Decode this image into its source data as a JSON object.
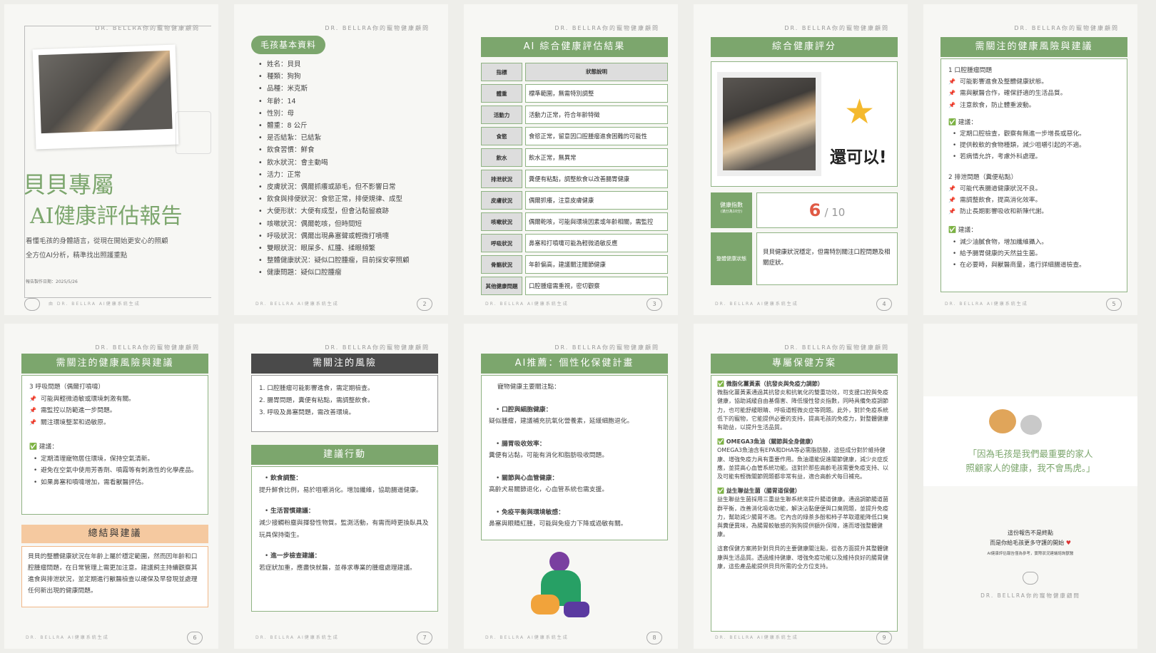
{
  "header": "DR. BELLRA你的寵物健康顧問",
  "footer": "DR. BELLRA AI健康系統生成",
  "p1": {
    "title1": "貝貝專屬",
    "title2": "AI健康評估報告",
    "desc1": "看懂毛孩的身體語言，從現在開始更安心的照顧",
    "desc2": "全方位AI分析，精準找出照護重點",
    "date": "報告製作日期：2025/5/26",
    "footer": "由 DR. BELLRA AI健康系統生成"
  },
  "p2": {
    "title": "毛孩基本資料",
    "items": [
      "姓名：貝貝",
      "種類：狗狗",
      "品種：米克斯",
      "年齡：14",
      "性別：母",
      "體重：8 公斤",
      "是否結紮：已結紮",
      "飲食習慣：鮮食",
      "飲水狀況：會主動喝",
      "活力：正常",
      "皮膚狀況：偶爾抓癢或舔毛，但不影響日常",
      "飲食與排便狀況：食慾正常，排便規律、成型",
      "大便形狀：大便有成型，但會沾黏留痕跡",
      "咳嗽狀況：偶爾乾咳，但時間短",
      "呼吸狀況：偶爾出現鼻塞聲或輕微打噴嚏",
      "雙眼狀況：眼屎多、紅腫、揉眼頻繁",
      "整體健康狀況：疑似口腔腫瘤，目前採安寧照顧",
      "健康問題：疑似口腔腫瘤"
    ],
    "page": "2"
  },
  "p3": {
    "title": "AI 綜合健康評估結果",
    "col1": "指標",
    "col2": "狀態說明",
    "rows": [
      [
        "體重",
        "標準範圍，無需特別調整"
      ],
      [
        "活動力",
        "活動力正常，符合年齡特徵"
      ],
      [
        "食慾",
        "食慾正常，留意因口腔腫瘤進食困難的可能性"
      ],
      [
        "飲水",
        "飲水正常，無異常"
      ],
      [
        "排泄狀況",
        "糞便有粘點，調整飲食以改善腸胃健康"
      ],
      [
        "皮膚狀況",
        "偶爾抓癢，注意皮膚健康"
      ],
      [
        "咳嗽狀況",
        "偶爾乾咳，可能與環境因素或年齡相關，需監控"
      ],
      [
        "呼吸狀況",
        "鼻塞和打噴嚏可能為輕微過敏反應"
      ],
      [
        "骨骼狀況",
        "年齡偏高，建議關注關節健康"
      ],
      [
        "其他健康問題",
        "口腔腫瘤需重視，密切觀察"
      ]
    ],
    "page": "3"
  },
  "p4": {
    "title": "綜合健康評分",
    "praise": "還可以!",
    "index_label": "健康指數",
    "index_sub": "(滿分為10分)",
    "score": "6",
    "score_max": "/ 10",
    "status_label": "整體健康狀態",
    "status_text": "貝貝健康狀況穩定，但需特別關注口腔問題及相關症狀。",
    "page": "4"
  },
  "p5": {
    "title": "需關注的健康風險與建議",
    "s1": "1 口腔腫瘤問題",
    "s1_pins": [
      "可能影響進食及整體健康狀態。",
      "需與獸醫合作，確保舒適的生活品質。",
      "注意飲食，防止體重波動。"
    ],
    "s1_adv": "建議：",
    "s1_tips": [
      "定期口腔檢查，觀察有無進一步增長或惡化。",
      "提供較軟的食物種類，減少咀嚼引起的不適。",
      "若病情允許，考慮外科處理。"
    ],
    "s2": "2 排泄問題（糞便粘點）",
    "s2_pins": [
      "可能代表腸道健康狀況不良。",
      "需調整飲食，提高消化效率。",
      "防止長期影響吸收和新陳代謝。"
    ],
    "s2_adv": "建議：",
    "s2_tips": [
      "減少油膩食物，增加纖維攝入。",
      "給予腸胃健康的天然益生菌。",
      "在必要時，與獸醫商量，進行詳細腸道檢查。"
    ],
    "page": "5"
  },
  "p6": {
    "title": "需關注的健康風險與建議",
    "s3": "3 呼吸問題（偶爾打噴嚏）",
    "pins": [
      "可能與輕微過敏或環境刺激有關。",
      "需監控以防範進一步問題。",
      "關注環境整潔和過敏原。"
    ],
    "adv": "建議：",
    "tips": [
      "定期清理寵物居住環境，保持空氣清新。",
      "避免在空氣中使用芳香劑、噴霧等有刺激性的化學產品。",
      "如果鼻塞和噴嚏增加，需看獸醫評估。"
    ],
    "sum_title": "總結與建議",
    "summary": "貝貝的整體健康狀況在年齡上屬於穩定範圍，然而因年齡和口腔腫瘤問題，在日常管理上需更加注意。建議飼主持續觀察其進食與排泄狀況，並定期進行獸醫檢查以確保及早發現並處理任何新出現的健康問題。",
    "page": "6"
  },
  "p7": {
    "title": "需關注的風險",
    "risks": [
      "1. 口腔腫瘤可能影響進食，需定期檢查。",
      "2. 腸胃問題，糞便有粘點，需調整飲食。",
      "3. 呼吸及鼻塞問題，需改善環境。"
    ],
    "action_title": "建議行動",
    "a1": "飲食調整：",
    "a1_text": "提升鮮食比例，易於咀嚼消化。增加纖維，協助腸道健康。",
    "a2": "生活習慣建議：",
    "a2_text": "減少接觸粉塵與揮發性物質。監測活動，有需而時更換臥具及玩具保持衛生。",
    "a3": "進一步檢查建議：",
    "a3_text": "若症狀加重，應盡快就醫，並尋求專業的腫瘤處理建議。",
    "page": "7"
  },
  "p8": {
    "title": "AI推薦：個性化保健計畫",
    "intro": "寵物健康主要關注點：",
    "i1": "口腔與細胞健康：",
    "i1_text": "疑似腫瘤，建議補充抗氧化營養素，延緩細胞退化。",
    "i2": "腸胃吸收效率：",
    "i2_text": "糞便有沾黏，可能有消化和脂肪吸收問題。",
    "i3": "關節與心血管健康：",
    "i3_text": "高齡犬易關節退化，心血管系統也需支援。",
    "i4": "免疫平衡與環境敏感：",
    "i4_text": "鼻塞與眼睛紅腫，可能與免疫力下降或過敏有關。",
    "page": "8"
  },
  "p9": {
    "title": "專屬保健方案",
    "h1": "微脂化薑黃素（抗發炎與免疫力調節）",
    "t1": "微脂化薑黃素通過其抗發炎和抗氧化的雙重功效，可支援口腔與免疫健康，協助減緩自由基傷害、降低慢性發炎指數，同時具備免疫調節力，也可能舒緩眼睛、呼吸道輕微炎症等問題。此外，對於免疫系統低下的寵物，它能提供必要的支持，提高毛孩的免疫力，對整體健康有助益，以提升生活品質。",
    "h2": "OMEGA3魚油（關節與全身健康）",
    "t2": "OMEGA3魚油含有EPA和DHA等必需脂肪酸，這些成分對於維持健康、增強免疫力具有重要作用。魚油還能促進關節健康，減少炎症反應，並提高心血管系統功能。這對於那些高齡毛孩需要免疫支持、以及可能有輕微關節問題都非常有益，適合高齡犬每日補充。",
    "h3": "益生聯益生菌（腸胃道保健）",
    "t3": "益生聯益生菌採用三重益生聯系統來提升腸道健康。通過調節腸道菌群平衡，改善消化吸收功能，解決沾黏便便與口臭問題，並提升免疫力，幫助減少腸胃不適。它內含的綠茶多酚和柿子萃取還能降低口臭與糞便異味，為腸胃較敏感的狗狗提供額外保障，進而增強整體健康。",
    "t4": "這套保健方案將針對貝貝的主要健康關注點，從各方面提升其整體健康與生活品質。透過維持健康、增強免疫功能以及維持良好的腸胃健康，這些產品能提供貝貝所需的全方位支持。",
    "page": "9"
  },
  "p10": {
    "quote1": "「因為毛孩是我們最重要的家人",
    "quote2": "照顧家人的健康，我不會馬虎。」",
    "end1": "這份報告不是終點",
    "end2": "而是你給毛孩更多守護的開始",
    "end3": "AI健康評估報告僅為參考，實際狀況建議諮詢獸醫",
    "brand": "DR. BELLRA你的寵物健康顧問"
  },
  "colors": {
    "green": "#7ca66d",
    "dark": "#4a4a4a",
    "peach": "#f5c9a0"
  }
}
